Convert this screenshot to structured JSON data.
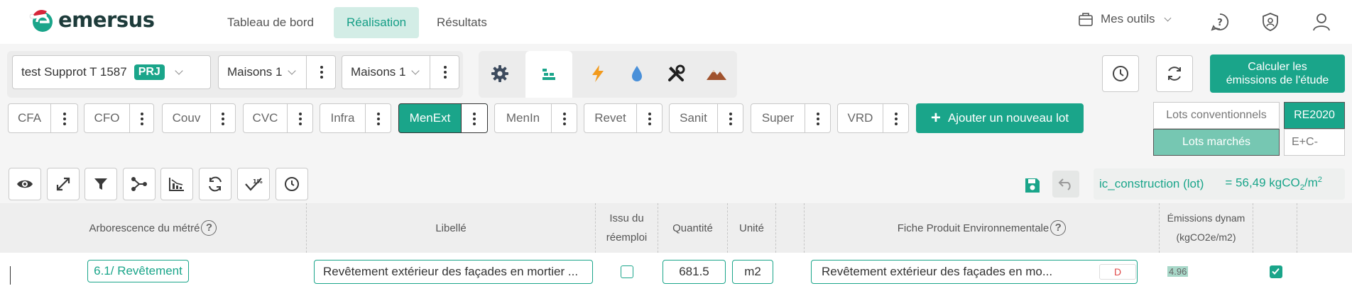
{
  "brand": {
    "name": "emersus",
    "accent": "#1aa58a"
  },
  "nav": {
    "items": [
      {
        "label": "Tableau de bord",
        "active": false
      },
      {
        "label": "Réalisation",
        "active": true
      },
      {
        "label": "Résultats",
        "active": false
      }
    ],
    "tools_label": "Mes outils"
  },
  "selectors": {
    "project": {
      "value": "test Supprot T 1587",
      "badge": "PRJ"
    },
    "building": {
      "value": "Maisons 1"
    },
    "zone": {
      "value": "Maisons 1"
    }
  },
  "category_icons": [
    "gear-icon",
    "layers-icon",
    "lightning-icon",
    "water-drop-icon",
    "tools-icon",
    "mountain-icon"
  ],
  "calc_button": {
    "line1": "Calculer les",
    "line2": "émissions de l'étude"
  },
  "lots": [
    {
      "label": "CFA",
      "active": false
    },
    {
      "label": "CFO",
      "active": false
    },
    {
      "label": "Couv",
      "active": false
    },
    {
      "label": "CVC",
      "active": false
    },
    {
      "label": "Infra",
      "active": false
    },
    {
      "label": "MenExt",
      "active": true
    },
    {
      "label": "MenIn",
      "active": false
    },
    {
      "label": "Revet",
      "active": false
    },
    {
      "label": "Sanit",
      "active": false
    },
    {
      "label": "Super",
      "active": false
    },
    {
      "label": "VRD",
      "active": false
    }
  ],
  "add_lot_label": "Ajouter un nouveau lot",
  "lot_types": {
    "conventional": "Lots conventionnels",
    "market": "Lots marchés"
  },
  "regulations": {
    "re2020": "RE2020",
    "ec": "E+C-"
  },
  "indicator": {
    "name": "ic_construction (lot)",
    "value": "= 56,49 kgCO",
    "sub": "2",
    "unit": "/m",
    "sup": "2"
  },
  "table": {
    "headers": {
      "tree": "Arborescence du métré",
      "label": "Libellé",
      "reuse_line1": "Issu du",
      "reuse_line2": "réemploi",
      "quantity": "Quantité",
      "unit": "Unité",
      "fiche": "Fiche Produit Environnementale",
      "emissions_line1": "Émissions dynam",
      "emissions_line2": "(kgCO2e/m2)"
    },
    "row": {
      "tree": "6.1/ Revêtement",
      "label": "Revêtement extérieur des façades en mortier ...",
      "reuse": false,
      "quantity": "681.5",
      "unit": "m2",
      "fiche": "Revêtement extérieur des façades en mo...",
      "fiche_tag": "D",
      "emissions": "4.96",
      "selected": true
    }
  }
}
